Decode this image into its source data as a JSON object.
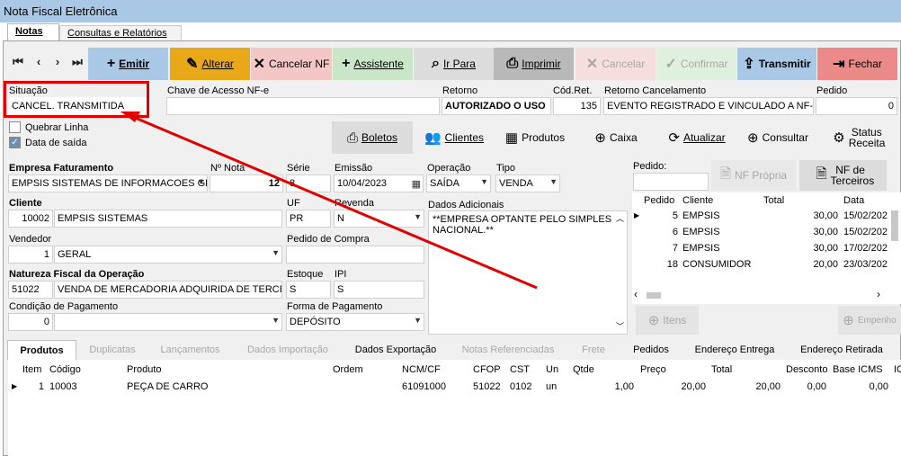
{
  "window": {
    "title": "Nota Fiscal Eletrônica"
  },
  "tabs": [
    {
      "label": "Notas"
    },
    {
      "label": "Consultas e Relatórios"
    }
  ],
  "nav": [
    "⏮",
    "‹",
    "›",
    "⏭"
  ],
  "toolbar": {
    "emitir": "Emitir",
    "alterar": "Alterar",
    "cancelar_nf": "Cancelar NF",
    "assistente": "Assistente",
    "ir_para": "Ir Para",
    "imprimir": "Imprimir",
    "cancelar": "Cancelar",
    "confirmar": "Confirmar",
    "transmitir": "Transmitir",
    "fechar": "Fechar"
  },
  "colors": {
    "emitir": "#a9c8e6",
    "alterar": "#e8a81a",
    "cancelar_nf": "#f4c7c7",
    "assistente": "#c9e6c9",
    "ir_para": "#dcdcdc",
    "imprimir": "#b9b9b9",
    "cancelar": "#f6dede",
    "confirmar": "#dff0df",
    "transmitir": "#a9c8e6",
    "fechar": "#ec8a8a",
    "annotation": "#e00000"
  },
  "header": {
    "situacao_label": "Situação",
    "situacao_value": "CANCEL. TRANSMITIDA",
    "chave_label": "Chave de Acesso NF-e",
    "chave_value": "",
    "retorno_label": "Retorno",
    "retorno_value": "AUTORIZADO O USO",
    "codret_label": "Cód.Ret.",
    "codret_value": "135",
    "retcanc_label": "Retorno Cancelamento",
    "retcanc_value": "EVENTO REGISTRADO E VINCULADO A NF-E",
    "pedido_label": "Pedido",
    "pedido_value": "0"
  },
  "checks": {
    "quebrar_linha": "Quebrar Linha",
    "data_saida": "Data de saída"
  },
  "section_buttons": {
    "boletos": "Boletos",
    "clientes": "Clientes",
    "produtos": "Produtos",
    "caixa": "Caixa",
    "atualizar": "Atualizar",
    "consultar": "Consultar",
    "status_receita": "Status Receita"
  },
  "form": {
    "empresa_label": "Empresa Faturamento",
    "empresa_value": "EMPSIS SISTEMAS DE INFORMACOES GEI",
    "nnota_label": "Nº Nota",
    "nnota_value": "12",
    "serie_label": "Série",
    "serie_value": "8",
    "emissao_label": "Emissão",
    "emissao_value": "10/04/2023",
    "operacao_label": "Operação",
    "operacao_value": "SAÍDA",
    "tipo_label": "Tipo",
    "tipo_value": "VENDA",
    "cliente_label": "Cliente",
    "cliente_code": "10002",
    "cliente_name": "EMPSIS SISTEMAS",
    "uf_label": "UF",
    "uf_value": "PR",
    "revenda_label": "Revenda",
    "revenda_value": "N",
    "dados_label": "Dados Adicionais",
    "dados_value": "**EMPRESA OPTANTE PELO SIMPLES NACIONAL.**",
    "vendedor_label": "Vendedor",
    "vendedor_code": "1",
    "vendedor_name": "GERAL",
    "pedcompra_label": "Pedido de Compra",
    "pedcompra_value": "",
    "natureza_label": "Natureza Fiscal da Operação",
    "natureza_code": "51022",
    "natureza_name": "VENDA DE MERCADORIA ADQUIRIDA DE TERCEIR",
    "estoque_label": "Estoque",
    "estoque_value": "S",
    "ipi_label": "IPI",
    "ipi_value": "S",
    "condpag_label": "Condição de Pagamento",
    "condpag_code": "0",
    "condpag_name": "",
    "formapag_label": "Forma de Pagamento",
    "formapag_value": "DEPÓSITO"
  },
  "right": {
    "pedido_label": "Pedido:",
    "nf_propria": "NF Própria",
    "nf_terceiros": "NF de Terceiros",
    "headers": [
      "Pedido",
      "Cliente",
      "Total",
      "Data"
    ],
    "rows": [
      {
        "pedido": "5",
        "cliente": "EMPSIS",
        "total": "30,00",
        "data": "15/02/202"
      },
      {
        "pedido": "6",
        "cliente": "EMPSIS",
        "total": "30,00",
        "data": "15/02/202"
      },
      {
        "pedido": "7",
        "cliente": "EMPSIS",
        "total": "30,00",
        "data": "17/02/202"
      },
      {
        "pedido": "18",
        "cliente": "CONSUMIDOR",
        "total": "20,00",
        "data": "23/03/202"
      }
    ],
    "itens": "Itens",
    "empenho": "Empenho"
  },
  "bottom_tabs": [
    "Produtos",
    "Duplicatas",
    "Lançamentos",
    "Dados Importação",
    "Dados Exportação",
    "Notas Referenciadas",
    "Frete",
    "Pedidos",
    "Endereço Entrega",
    "Endereço Retirada"
  ],
  "items": {
    "headers": [
      "Item",
      "Código",
      "Produto",
      "Ordem",
      "NCM/CF",
      "CFOP",
      "CST",
      "Un",
      "Qtde",
      "Preço",
      "Total",
      "Desconto",
      "Base ICMS",
      "IC"
    ],
    "rows": [
      {
        "item": "1",
        "codigo": "10003",
        "produto": "PEÇA DE CARRO",
        "ordem": "",
        "ncm": "61091000",
        "cfop": "51022",
        "cst": "0102",
        "un": "un",
        "qtde": "1,00",
        "preco": "20,00",
        "total": "20,00",
        "desconto": "0,00",
        "base": "0,00"
      }
    ]
  }
}
